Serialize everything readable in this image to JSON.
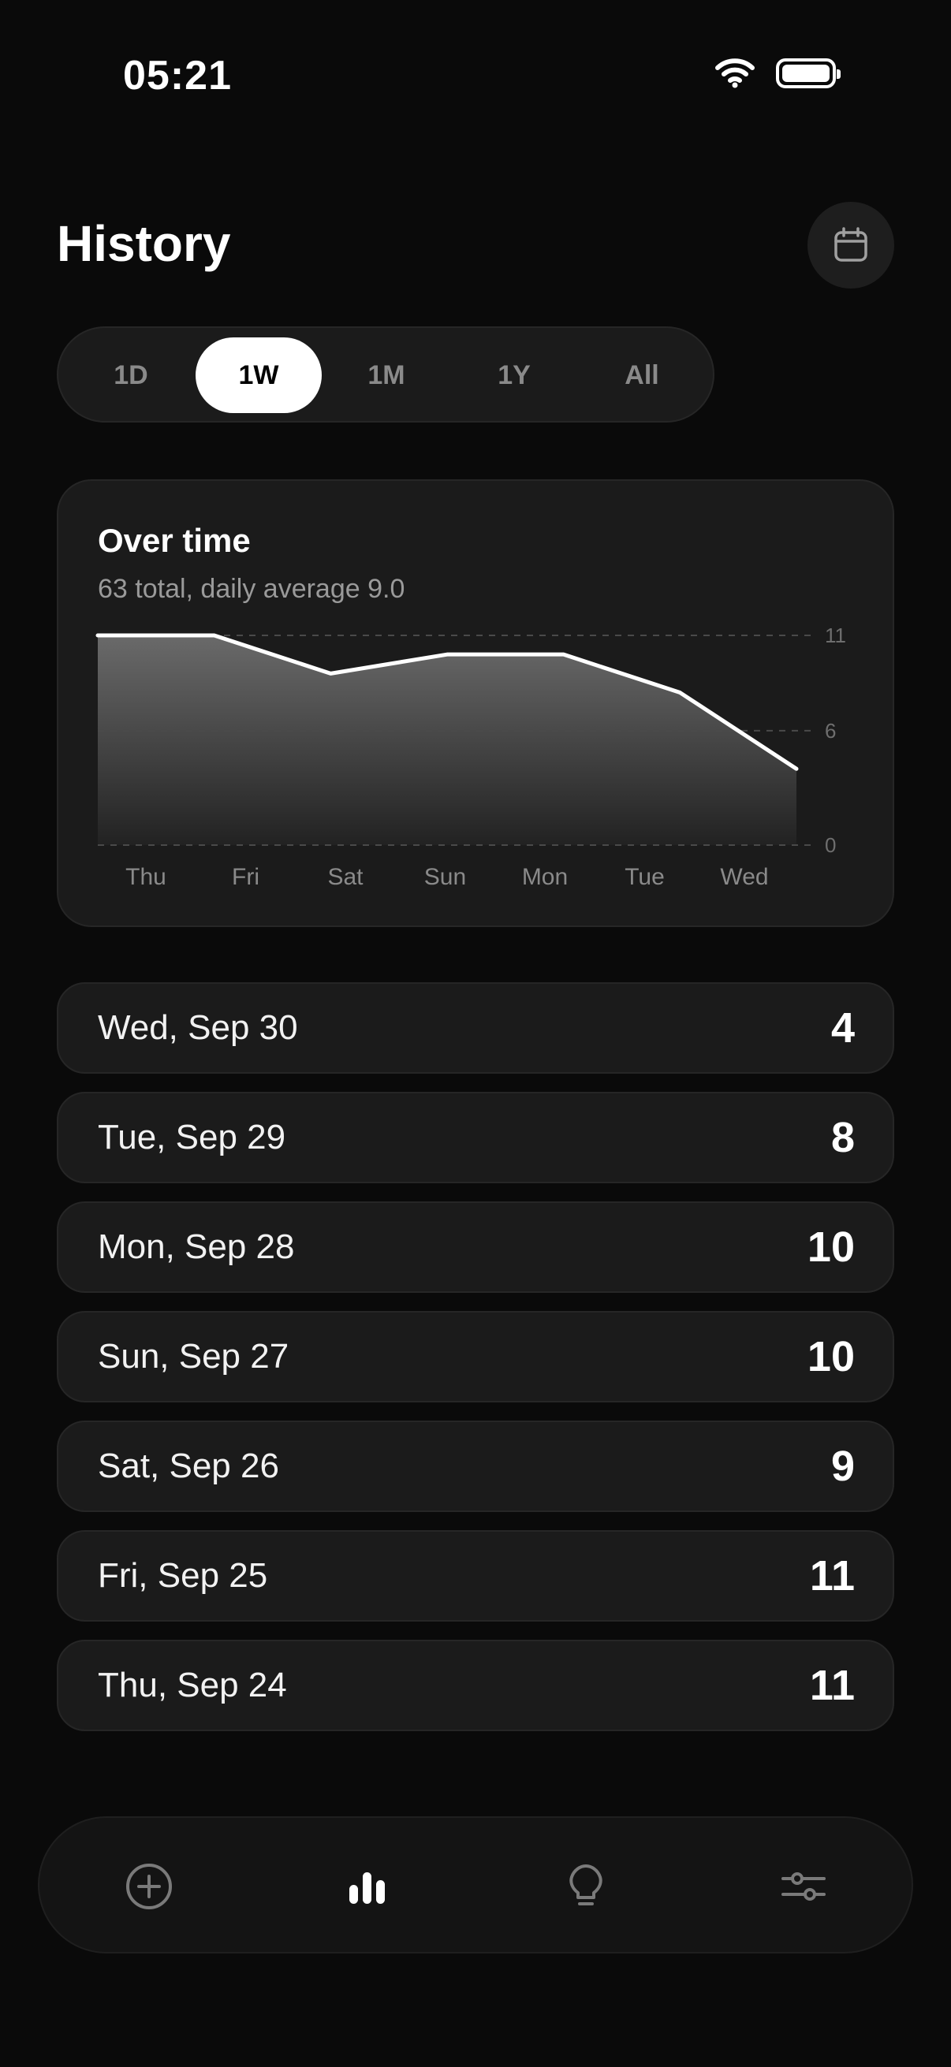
{
  "status": {
    "time": "05:21"
  },
  "header": {
    "title": "History",
    "calendar_icon": "calendar-icon"
  },
  "range_tabs": [
    {
      "label": "1D",
      "active": false
    },
    {
      "label": "1W",
      "active": true
    },
    {
      "label": "1M",
      "active": false
    },
    {
      "label": "1Y",
      "active": false
    },
    {
      "label": "All",
      "active": false
    }
  ],
  "chart_card": {
    "title": "Over time",
    "subtitle": "63 total, daily average 9.0"
  },
  "chart_data": {
    "type": "area",
    "categories": [
      "Thu",
      "Fri",
      "Sat",
      "Sun",
      "Mon",
      "Tue",
      "Wed"
    ],
    "values": [
      11,
      11,
      9,
      10,
      10,
      8,
      4
    ],
    "y_ticks": [
      "11",
      "6",
      "0"
    ],
    "ylim": [
      0,
      11
    ],
    "grid": true,
    "colors": {
      "line": "#ffffff",
      "grid": "#4a4a4a"
    }
  },
  "days": [
    {
      "label": "Wed, Sep 30",
      "count": "4"
    },
    {
      "label": "Tue, Sep 29",
      "count": "8"
    },
    {
      "label": "Mon, Sep 28",
      "count": "10"
    },
    {
      "label": "Sun, Sep 27",
      "count": "10"
    },
    {
      "label": "Sat, Sep 26",
      "count": "9"
    },
    {
      "label": "Fri, Sep 25",
      "count": "11"
    },
    {
      "label": "Thu, Sep 24",
      "count": "11"
    }
  ],
  "tabbar": [
    {
      "icon": "add-circle-icon",
      "active": false
    },
    {
      "icon": "bar-chart-icon",
      "active": true
    },
    {
      "icon": "lightbulb-icon",
      "active": false
    },
    {
      "icon": "sliders-icon",
      "active": false
    }
  ]
}
